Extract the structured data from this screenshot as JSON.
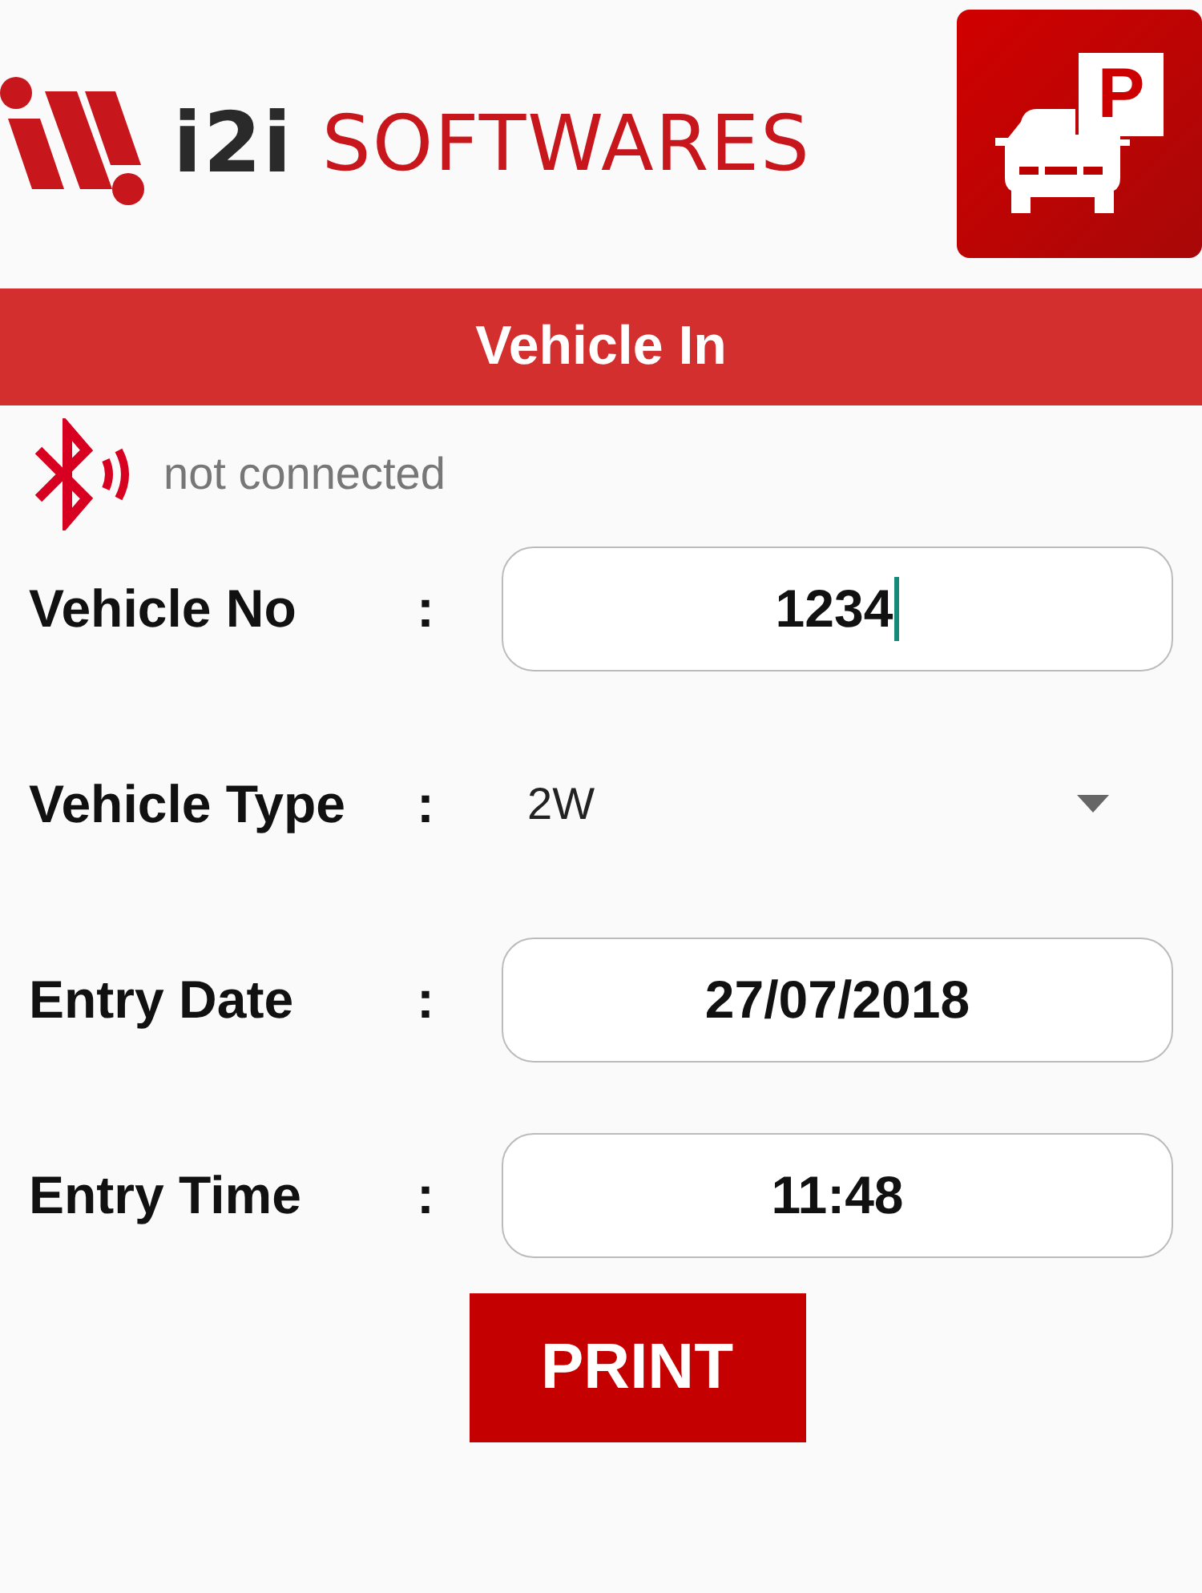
{
  "header": {
    "logo_prefix": "i2i",
    "logo_name": "SOFTWARES",
    "parking_sign": "P"
  },
  "title_bar": {
    "title": "Vehicle In"
  },
  "printer_status": {
    "connected": false,
    "text": "not connected"
  },
  "form": [
    {
      "kind": "input",
      "label": "Vehicle No",
      "separator": ":",
      "value": "1234",
      "focused": true
    },
    {
      "kind": "dropdown",
      "label": "Vehicle Type",
      "separator": ":",
      "value": "2W"
    },
    {
      "kind": "input",
      "label": "Entry Date",
      "separator": ":",
      "value": "27/07/2018",
      "focused": false
    },
    {
      "kind": "input",
      "label": "Entry Time",
      "separator": ":",
      "value": "11:48",
      "focused": false
    }
  ],
  "buttons": [
    {
      "label": "PRINT"
    }
  ]
}
